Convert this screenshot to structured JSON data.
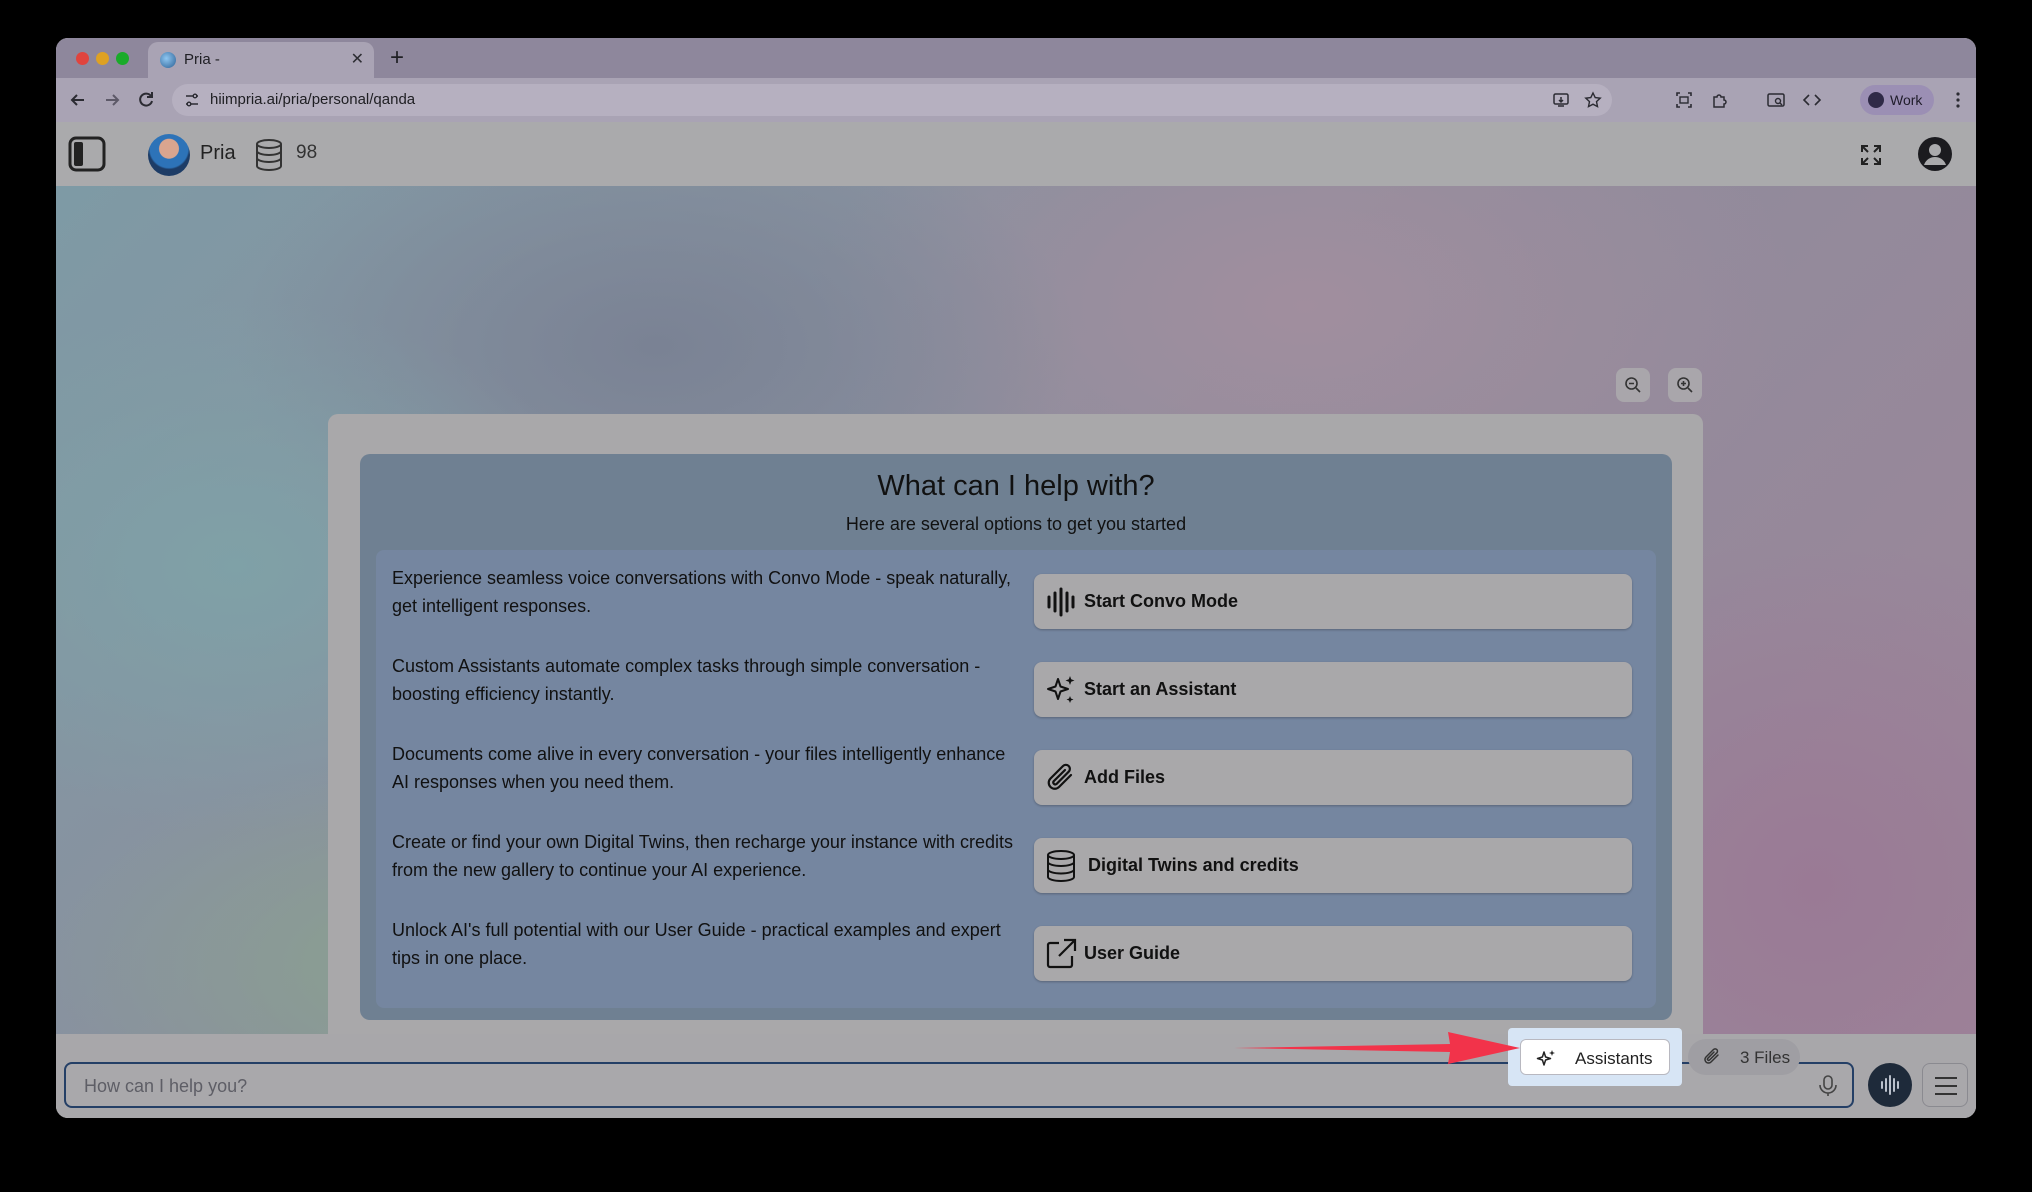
{
  "browser": {
    "tab_title": "Pria -",
    "url": "hiimpria.ai/pria/personal/qanda",
    "profile_label": "Work"
  },
  "header": {
    "app_name": "Pria",
    "credits": "98"
  },
  "welcome": {
    "title": "What can I help with?",
    "subtitle": "Here are several options to get you started",
    "options": [
      {
        "description": "Experience seamless voice conversations with Convo Mode - speak naturally, get intelligent responses.",
        "button": "Start Convo Mode",
        "icon": "audio-waveform-icon"
      },
      {
        "description": "Custom Assistants automate complex tasks through simple conversation - boosting efficiency instantly.",
        "button": "Start an Assistant",
        "icon": "sparkles-icon"
      },
      {
        "description": "Documents come alive in every conversation - your files intelligently enhance AI responses when you need them.",
        "button": "Add Files",
        "icon": "paperclip-icon"
      },
      {
        "description": "Create or find your own Digital Twins, then recharge your instance with credits from the new gallery to continue your AI experience.",
        "button": "Digital Twins and credits",
        "icon": "database-icon"
      },
      {
        "description": "Unlock AI's full potential with our User Guide - practical examples and expert tips in one place.",
        "button": "User Guide",
        "icon": "external-link-icon"
      }
    ]
  },
  "chat": {
    "placeholder": "How can I help you?",
    "assistants_label": "Assistants",
    "files_label": "3 Files"
  },
  "colors": {
    "accent_dark": "#243f66",
    "highlight": "#d7e5f5",
    "annotation_arrow": "#f2334a"
  }
}
